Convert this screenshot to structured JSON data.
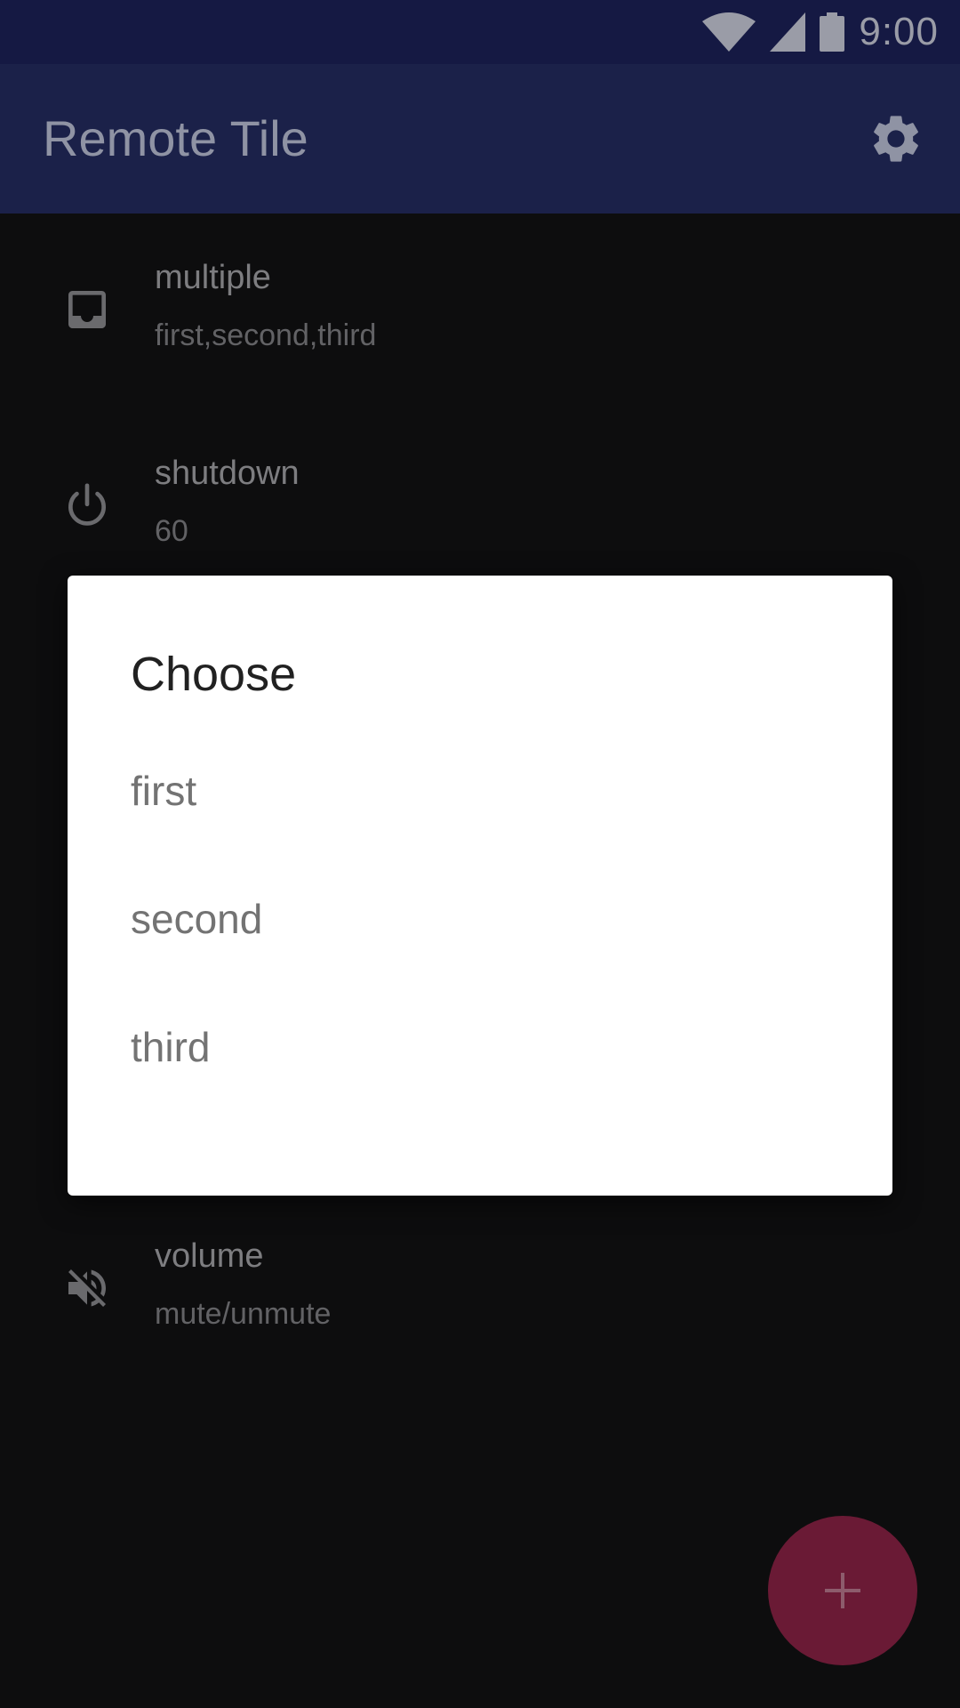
{
  "status_bar": {
    "time": "9:00",
    "icons": [
      "wifi-icon",
      "cell-signal-icon",
      "battery-icon"
    ]
  },
  "app_bar": {
    "title": "Remote Tile",
    "action_icon": "gear-icon"
  },
  "tiles": [
    {
      "icon": "inbox-tray-icon",
      "title": "multiple",
      "subtitle": "first,second,third"
    },
    {
      "icon": "power-icon",
      "title": "shutdown",
      "subtitle": "60"
    },
    {
      "icon": "volume-off-icon",
      "title": "volume",
      "subtitle": "mute/unmute"
    }
  ],
  "dialog": {
    "title": "Choose",
    "options": [
      "first",
      "second",
      "third"
    ]
  },
  "fab": {
    "icon": "plus-icon"
  },
  "colors": {
    "status_bar": "#151943",
    "app_bar": "#1b2149",
    "scrim_background": "#0d0d0e",
    "fab": "#6a1a35",
    "dialog_background": "#ffffff"
  }
}
